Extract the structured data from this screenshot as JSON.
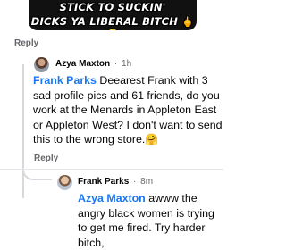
{
  "meme": {
    "line1": "STICK TO SUCKIN'",
    "line2": "DICKS YA LIBERAL BITCH",
    "emojis": "🖕🤣"
  },
  "replies": {
    "top_label": "Reply",
    "mid_label": "Reply"
  },
  "comments": [
    {
      "author": "Azya Maxton",
      "separator": "·",
      "time": "1h",
      "mention": "Frank Parks",
      "text": " Deearest Frank with 3 sad profile pics and 61 friends, do you work at the Menards in Appleton East or Appleton West? I don't want to send this to the wrong store.",
      "emoji": "🤗"
    },
    {
      "author": "Frank Parks",
      "separator": "·",
      "time": "8m",
      "mention": "Azya Maxton",
      "text": " awww the angry black women is trying to get me fired. Try harder bitch,"
    }
  ]
}
